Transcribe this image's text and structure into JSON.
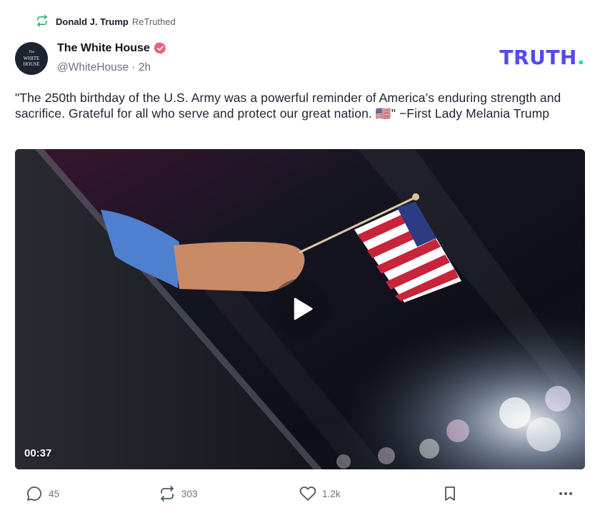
{
  "retruth": {
    "icon": "retruth-icon",
    "user": "Donald J. Trump",
    "label": "ReTruthed"
  },
  "author": {
    "avatar_line1": "The",
    "avatar_line2": "WHITE",
    "avatar_line3": "HOUSE",
    "name": "The White House",
    "verified_icon": "verified-badge-icon",
    "handle_time": "@WhiteHouse · 2h"
  },
  "brand": {
    "text": "TRUTH",
    "dot": ".",
    "color": "#5448ee",
    "dot_color": "#17e1c7"
  },
  "post": {
    "text": "\"The 250th birthday of the U.S. Army was a powerful reminder of America’s enduring strength and sacrifice. Grateful for all who serve and protect our great nation. 🇺🇸\" −First Lady Melania Trump"
  },
  "video": {
    "duration": "00:37",
    "play_icon": "play-icon"
  },
  "actions": {
    "reply_count": "45",
    "retruth_count": "303",
    "like_count": "1.2k",
    "reply_icon": "comment-icon",
    "retruth_icon": "retruth-icon",
    "like_icon": "heart-icon",
    "bookmark_icon": "bookmark-icon",
    "more_icon": "more-icon"
  }
}
